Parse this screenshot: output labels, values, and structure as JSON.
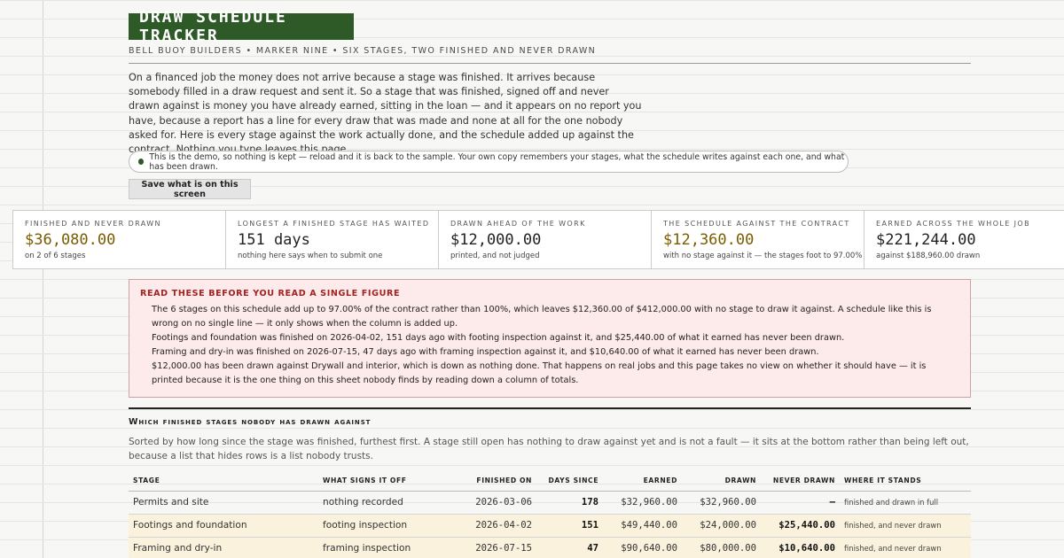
{
  "header": {
    "title": "DRAW SCHEDULE TRACKER",
    "subtitle": "BELL BUOY BUILDERS • MARKER NINE • SIX STAGES, TWO FINISHED AND NEVER DRAWN"
  },
  "intro": "On a financed job the money does not arrive because a stage was finished. It arrives because somebody filled in a draw request and sent it. So a stage that was finished, signed off and never drawn against is money you have already earned, sitting in the loan — and it appears on no report you have, because a report has a line for every draw that was made and none at all for the one nobody asked for. Here is every stage against the work actually done, and the schedule added up against the contract. Nothing you type leaves this page.",
  "demo_notice": "This is the demo, so nothing is kept — reload and it is back to the sample. Your own copy remembers your stages, what the schedule writes against each one, and what has been drawn.",
  "save_button": "Save what is on this screen",
  "stats": [
    {
      "label": "Finished and never drawn",
      "value": "$36,080.00",
      "note": "on 2 of 6 stages",
      "accent": true
    },
    {
      "label": "Longest a finished stage has waited",
      "value": "151 days",
      "note": "nothing here says when to submit one",
      "accent": false
    },
    {
      "label": "Drawn ahead of the work",
      "value": "$12,000.00",
      "note": "printed, and not judged",
      "accent": false
    },
    {
      "label": "The schedule against the contract",
      "value": "$12,360.00",
      "note": "with no stage against it — the stages foot to 97.00%",
      "accent": true
    },
    {
      "label": "Earned across the whole job",
      "value": "$221,244.00",
      "note": "against $188,960.00 drawn",
      "accent": false
    }
  ],
  "warning": {
    "title": "Read these before you read a single figure",
    "items": [
      "The 6 stages on this schedule add up to 97.00% of the contract rather than 100%, which leaves $12,360.00 of $412,000.00 with no stage to draw it against. A schedule like this is wrong on no single line — it only shows when the column is added up.",
      "Footings and foundation was finished on 2026-04-02, 151 days ago with footing inspection against it, and $25,440.00 of what it earned has never been drawn.",
      "Framing and dry-in was finished on 2026-07-15, 47 days ago with framing inspection against it, and $10,640.00 of what it earned has never been drawn.",
      "$12,000.00 has been drawn against Drywall and interior, which is down as nothing done. That happens on real jobs and this page takes no view on whether it should have — it is printed because it is the one thing on this sheet nobody finds by reading down a column of totals."
    ]
  },
  "section": {
    "heading": "Which finished stages nobody has drawn against",
    "description": "Sorted by how long since the stage was finished, furthest first. A stage still open has nothing to draw against yet and is not a fault — it sits at the bottom rather than being left out, because a list that hides rows is a list nobody trusts."
  },
  "table": {
    "headers": [
      "Stage",
      "What signs it off",
      "Finished on",
      "Days since",
      "Earned",
      "Drawn",
      "Never drawn",
      "Where it stands"
    ],
    "rows": [
      {
        "stage": "Permits and site",
        "signoff": "nothing recorded",
        "finished": "2026-03-06",
        "days": "178",
        "earned": "$32,960.00",
        "drawn": "$32,960.00",
        "never": "—",
        "status": "finished and drawn in full"
      },
      {
        "stage": "Footings and foundation",
        "signoff": "footing inspection",
        "finished": "2026-04-02",
        "days": "151",
        "earned": "$49,440.00",
        "drawn": "$24,000.00",
        "never": "$25,440.00",
        "status": "finished, and never drawn"
      },
      {
        "stage": "Framing and dry-in",
        "signoff": "framing inspection",
        "finished": "2026-07-15",
        "days": "47",
        "earned": "$90,640.00",
        "drawn": "$80,000.00",
        "never": "$10,640.00",
        "status": "finished, and never drawn"
      }
    ]
  },
  "colors": {
    "title_bg": "#2d5a27",
    "accent_gold": "#7a5c00",
    "warning_bg": "#fdeaea",
    "warning_title": "#a32222",
    "highlight_row": "#fbf2de"
  }
}
